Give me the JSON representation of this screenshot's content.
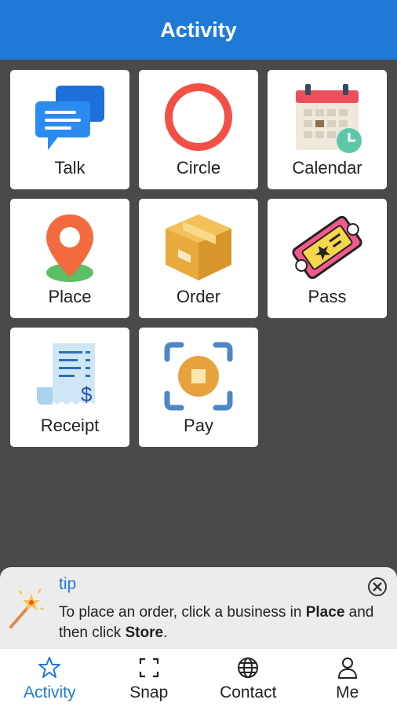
{
  "header": {
    "title": "Activity"
  },
  "tiles": [
    {
      "label": "Talk",
      "icon": "chat-bubbles-icon"
    },
    {
      "label": "Circle",
      "icon": "circle-ring-icon"
    },
    {
      "label": "Calendar",
      "icon": "calendar-icon"
    },
    {
      "label": "Place",
      "icon": "location-pin-icon"
    },
    {
      "label": "Order",
      "icon": "package-box-icon"
    },
    {
      "label": "Pass",
      "icon": "ticket-icon"
    },
    {
      "label": "Receipt",
      "icon": "receipt-icon"
    },
    {
      "label": "Pay",
      "icon": "scan-pay-icon"
    }
  ],
  "tip": {
    "title": "tip",
    "text_1": "To place an order, click a business in ",
    "bold_1": "Place",
    "text_2": " and then click ",
    "bold_2": "Store",
    "text_3": "."
  },
  "tabbar": {
    "items": [
      {
        "label": "Activity",
        "icon": "star-icon",
        "active": true
      },
      {
        "label": "Snap",
        "icon": "scan-frame-icon",
        "active": false
      },
      {
        "label": "Contact",
        "icon": "globe-icon",
        "active": false
      },
      {
        "label": "Me",
        "icon": "person-icon",
        "active": false
      }
    ]
  },
  "colors": {
    "accent": "#1f7ad6",
    "background": "#4a4a4a",
    "header": "#1f7ad6"
  }
}
